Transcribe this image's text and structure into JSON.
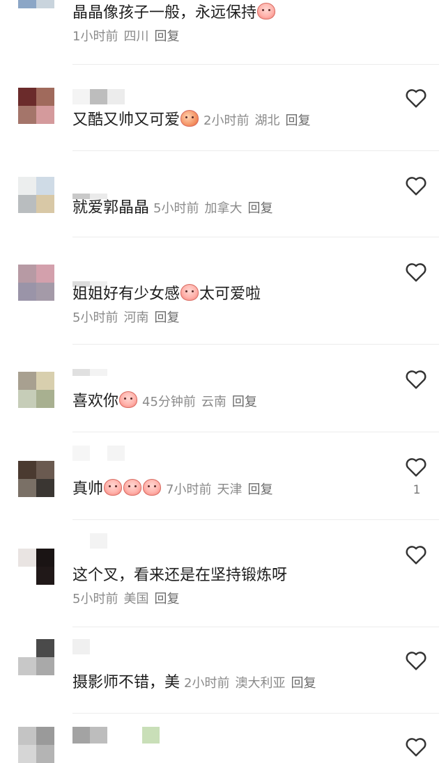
{
  "colors": {
    "meta": "#8a8a8a",
    "text": "#1d1d1d",
    "divider": "#ececec",
    "heart": "#333333"
  },
  "comments": [
    {
      "text": "晶晶像孩子一般，永远保持",
      "emoji": "pig-face-emoji",
      "time": "1小时前",
      "location": "四川",
      "reply": "回复"
    },
    {
      "text": "又酷又帅又可爱",
      "emoji": "peach-emoji",
      "time": "2小时前",
      "location": "湖北",
      "reply": "回复"
    },
    {
      "text": "就爱郭晶晶",
      "time": "5小时前",
      "location": "加拿大",
      "reply": "回复"
    },
    {
      "text_before": "姐姐好有少女感",
      "emoji": "blushing-pig-emoji",
      "text_after": "太可爱啦",
      "time": "5小时前",
      "location": "河南",
      "reply": "回复"
    },
    {
      "text": "喜欢你",
      "emoji": "blushing-pig-emoji",
      "time": "45分钟前",
      "location": "云南",
      "reply": "回复"
    },
    {
      "text": "真帅",
      "emoji": "pig-face-emoji",
      "time": "7小时前",
      "location": "天津",
      "reply": "回复",
      "likes": "1"
    },
    {
      "text": "这个叉，看来还是在坚持锻炼呀",
      "time": "5小时前",
      "location": "美国",
      "reply": "回复"
    },
    {
      "text": "摄影师不错，美",
      "time": "2小时前",
      "location": "澳大利亚",
      "reply": "回复"
    }
  ]
}
